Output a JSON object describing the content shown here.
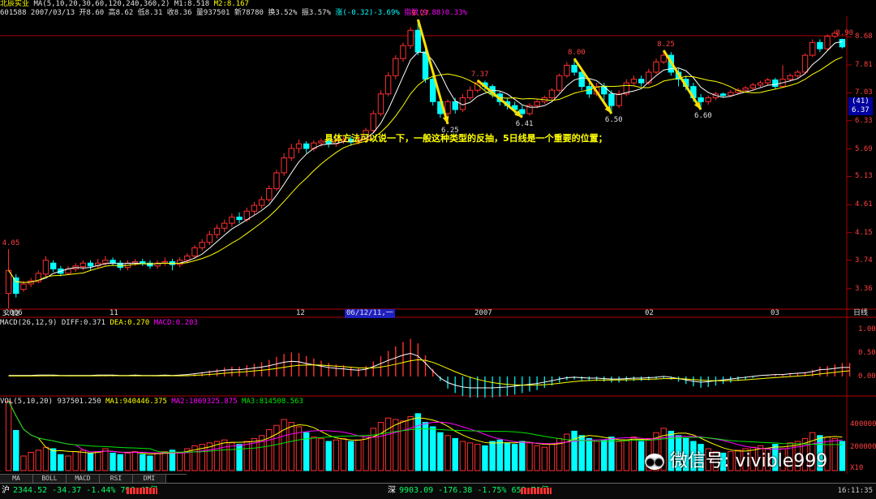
{
  "header": {
    "stock_name": "北辰实业",
    "ma_label": "MA(5,10,20,30,60,120,240,360,2)",
    "m1": "M1:8.518",
    "m2": "M2:8.167",
    "line2": "601588 2007/03/13 开8.60 高8.62 低8.31 收8.36 量937501 新78780 换3.52% 振3.57%",
    "change": "涨(-0.32)-3.69%",
    "index": "指数(9.88)0.33%"
  },
  "price_axis": {
    "ticks": [
      "8.68",
      "7.81",
      "7.03",
      "6.33",
      "5.69",
      "5.13",
      "4.61",
      "4.15",
      "3.74",
      "3.36"
    ],
    "badge_top": "(41)",
    "badge_bottom": "6.37"
  },
  "time_axis": {
    "labels": [
      "2006",
      "11",
      "12",
      "06/12/11,一",
      "2007",
      "02",
      "03",
      "日线"
    ]
  },
  "annotations": {
    "labels": [
      "9.27",
      "6.25",
      "7.37",
      "6.41",
      "8.00",
      "6.50",
      "8.25",
      "6.60",
      "8.90",
      "4.05",
      "3.12"
    ],
    "note": "具体方法可以说一下，一般这种类型的反抽，5日线是一个重要的位置；"
  },
  "macd_panel": {
    "title": "MACD(26,12,9)",
    "diff": "DIFF:0.371",
    "dea": "DEA:0.270",
    "macd": "MACD:0.203",
    "ticks": [
      "1.00",
      "0.50",
      "0.00"
    ]
  },
  "volume_panel": {
    "title": "VOL(5,10,20)",
    "vol": "937501.250",
    "ma1": "MA1:940446.375",
    "ma2": "MA2:1069325.875",
    "ma3": "MA3:814508.563",
    "ticks": [
      "400000",
      "200000",
      "X10"
    ]
  },
  "tabs": [
    "MA",
    "BOLL",
    "MACD",
    "RSI",
    "DMI"
  ],
  "status_bar": {
    "sh_label": "沪",
    "sh_value": "2344.52 -34.37 -1.44% 796.42亿",
    "sz_label": "深",
    "sz_value": "9903.09 -176.38 -1.75% 652.70亿",
    "time": "16:11:35"
  },
  "watermark": "微信号: vivible999",
  "colors": {
    "up": "#ff3030",
    "down": "#00ffff",
    "ma5": "#ffffff",
    "ma10": "#ffff00",
    "ma20": "#ff00ff",
    "arrow": "#ffe000"
  },
  "chart_data": {
    "type": "candlestick",
    "title": "北辰实业",
    "ylim": [
      3.12,
      9.27
    ],
    "y_scale": "log",
    "candles": [
      [
        3.3,
        3.6,
        3.12,
        3.9
      ],
      [
        3.5,
        3.3,
        3.25,
        3.55
      ],
      [
        3.35,
        3.42,
        3.32,
        3.46
      ],
      [
        3.42,
        3.46,
        3.38,
        3.5
      ],
      [
        3.45,
        3.56,
        3.43,
        3.6
      ],
      [
        3.55,
        3.74,
        3.52,
        3.8
      ],
      [
        3.7,
        3.62,
        3.58,
        3.74
      ],
      [
        3.62,
        3.56,
        3.52,
        3.66
      ],
      [
        3.56,
        3.62,
        3.54,
        3.66
      ],
      [
        3.62,
        3.66,
        3.58,
        3.7
      ],
      [
        3.65,
        3.7,
        3.6,
        3.74
      ],
      [
        3.7,
        3.66,
        3.6,
        3.74
      ],
      [
        3.66,
        3.7,
        3.62,
        3.76
      ],
      [
        3.7,
        3.74,
        3.66,
        3.8
      ],
      [
        3.74,
        3.7,
        3.66,
        3.78
      ],
      [
        3.7,
        3.64,
        3.6,
        3.74
      ],
      [
        3.64,
        3.7,
        3.6,
        3.74
      ],
      [
        3.7,
        3.72,
        3.66,
        3.76
      ],
      [
        3.72,
        3.7,
        3.66,
        3.76
      ],
      [
        3.7,
        3.66,
        3.62,
        3.74
      ],
      [
        3.66,
        3.7,
        3.62,
        3.74
      ],
      [
        3.7,
        3.72,
        3.66,
        3.78
      ],
      [
        3.72,
        3.68,
        3.6,
        3.76
      ],
      [
        3.68,
        3.74,
        3.64,
        3.78
      ],
      [
        3.74,
        3.8,
        3.7,
        3.84
      ],
      [
        3.8,
        3.92,
        3.76,
        3.96
      ],
      [
        3.92,
        4.0,
        3.88,
        4.05
      ],
      [
        4.0,
        4.12,
        3.96,
        4.18
      ],
      [
        4.12,
        4.22,
        4.06,
        4.28
      ],
      [
        4.22,
        4.3,
        4.16,
        4.36
      ],
      [
        4.3,
        4.4,
        4.24,
        4.46
      ],
      [
        4.4,
        4.36,
        4.3,
        4.48
      ],
      [
        4.36,
        4.5,
        4.32,
        4.56
      ],
      [
        4.5,
        4.6,
        4.44,
        4.66
      ],
      [
        4.6,
        4.7,
        4.54,
        4.76
      ],
      [
        4.7,
        4.9,
        4.66,
        4.96
      ],
      [
        4.9,
        5.2,
        4.86,
        5.26
      ],
      [
        5.2,
        5.5,
        5.14,
        5.6
      ],
      [
        5.5,
        5.7,
        5.44,
        5.8
      ],
      [
        5.7,
        5.8,
        5.6,
        5.9
      ],
      [
        5.8,
        5.7,
        5.6,
        5.86
      ],
      [
        5.7,
        5.82,
        5.64,
        5.88
      ],
      [
        5.82,
        5.86,
        5.74,
        5.92
      ],
      [
        5.86,
        5.8,
        5.72,
        5.92
      ],
      [
        5.8,
        5.86,
        5.74,
        5.94
      ],
      [
        5.86,
        5.9,
        5.8,
        5.96
      ],
      [
        5.9,
        5.84,
        5.76,
        5.96
      ],
      [
        5.84,
        5.9,
        5.78,
        5.98
      ],
      [
        5.9,
        6.1,
        5.86,
        6.16
      ],
      [
        6.1,
        6.5,
        6.04,
        6.58
      ],
      [
        6.5,
        7.0,
        6.44,
        7.1
      ],
      [
        7.0,
        7.5,
        6.94,
        7.6
      ],
      [
        7.5,
        8.0,
        7.4,
        8.1
      ],
      [
        8.0,
        8.4,
        7.9,
        8.5
      ],
      [
        8.4,
        8.9,
        8.3,
        9.0
      ],
      [
        8.9,
        8.2,
        8.1,
        9.27
      ],
      [
        8.2,
        7.4,
        7.3,
        8.3
      ],
      [
        7.4,
        6.8,
        6.7,
        7.5
      ],
      [
        6.8,
        6.5,
        6.4,
        6.9
      ],
      [
        6.5,
        6.8,
        6.25,
        6.86
      ],
      [
        6.8,
        6.6,
        6.5,
        6.9
      ],
      [
        6.6,
        6.9,
        6.54,
        7.0
      ],
      [
        6.9,
        7.1,
        6.84,
        7.2
      ],
      [
        7.1,
        7.3,
        7.04,
        7.37
      ],
      [
        7.3,
        7.2,
        7.1,
        7.36
      ],
      [
        7.2,
        7.0,
        6.9,
        7.26
      ],
      [
        7.0,
        6.8,
        6.7,
        7.06
      ],
      [
        6.8,
        6.7,
        6.6,
        6.9
      ],
      [
        6.7,
        6.6,
        6.5,
        6.8
      ],
      [
        6.6,
        6.5,
        6.41,
        6.7
      ],
      [
        6.5,
        6.7,
        6.45,
        6.76
      ],
      [
        6.7,
        6.8,
        6.64,
        6.86
      ],
      [
        6.8,
        6.9,
        6.74,
        6.96
      ],
      [
        6.9,
        7.1,
        6.84,
        7.16
      ],
      [
        7.1,
        7.5,
        7.04,
        7.56
      ],
      [
        7.5,
        7.8,
        7.44,
        7.9
      ],
      [
        7.8,
        7.6,
        7.5,
        8.0
      ],
      [
        7.6,
        7.2,
        7.1,
        7.7
      ],
      [
        7.2,
        7.0,
        6.9,
        7.3
      ],
      [
        7.0,
        7.2,
        6.94,
        7.3
      ],
      [
        7.2,
        7.0,
        6.8,
        7.3
      ],
      [
        7.0,
        6.7,
        6.5,
        7.1
      ],
      [
        6.7,
        7.0,
        6.64,
        7.1
      ],
      [
        7.0,
        7.3,
        6.94,
        7.4
      ],
      [
        7.3,
        7.4,
        7.24,
        7.5
      ],
      [
        7.4,
        7.3,
        7.2,
        7.5
      ],
      [
        7.3,
        7.6,
        7.24,
        7.7
      ],
      [
        7.6,
        7.9,
        7.54,
        8.0
      ],
      [
        7.9,
        8.1,
        7.84,
        8.25
      ],
      [
        8.1,
        7.6,
        7.5,
        8.2
      ],
      [
        7.6,
        7.4,
        7.2,
        7.7
      ],
      [
        7.4,
        7.2,
        7.1,
        7.5
      ],
      [
        7.2,
        6.9,
        6.8,
        7.3
      ],
      [
        6.9,
        6.8,
        6.6,
        7.0
      ],
      [
        6.8,
        6.9,
        6.72,
        6.96
      ],
      [
        6.9,
        7.0,
        6.84,
        7.06
      ],
      [
        7.0,
        6.96,
        6.9,
        7.04
      ],
      [
        6.96,
        7.04,
        6.92,
        7.1
      ],
      [
        7.04,
        7.1,
        6.98,
        7.16
      ],
      [
        7.1,
        7.16,
        7.04,
        7.22
      ],
      [
        7.16,
        7.24,
        7.1,
        7.3
      ],
      [
        7.24,
        7.3,
        7.18,
        7.36
      ],
      [
        7.3,
        7.38,
        7.24,
        7.44
      ],
      [
        7.38,
        7.2,
        7.14,
        7.44
      ],
      [
        7.2,
        7.4,
        7.16,
        7.8
      ],
      [
        7.4,
        7.5,
        7.34,
        7.56
      ],
      [
        7.5,
        7.6,
        7.44,
        7.66
      ],
      [
        7.6,
        8.1,
        7.54,
        8.16
      ],
      [
        8.1,
        8.5,
        8.04,
        8.6
      ],
      [
        8.5,
        8.3,
        8.2,
        8.6
      ],
      [
        8.3,
        8.7,
        8.24,
        8.76
      ],
      [
        8.7,
        8.8,
        8.64,
        8.9
      ],
      [
        8.6,
        8.36,
        8.31,
        8.62
      ]
    ],
    "volume": [
      95,
      55,
      20,
      25,
      28,
      32,
      30,
      22,
      20,
      26,
      28,
      24,
      26,
      30,
      24,
      22,
      24,
      26,
      22,
      20,
      24,
      26,
      28,
      24,
      30,
      34,
      36,
      38,
      40,
      42,
      38,
      36,
      40,
      44,
      48,
      56,
      62,
      70,
      66,
      60,
      52,
      46,
      44,
      40,
      42,
      44,
      40,
      42,
      48,
      58,
      66,
      72,
      70,
      68,
      74,
      78,
      66,
      60,
      52,
      48,
      44,
      40,
      38,
      36,
      34,
      40,
      42,
      38,
      36,
      40,
      38,
      34,
      32,
      36,
      44,
      50,
      54,
      48,
      44,
      40,
      42,
      46,
      40,
      42,
      46,
      40,
      44,
      52,
      58,
      54,
      48,
      44,
      40,
      36,
      30,
      26,
      24,
      26,
      28,
      30,
      32,
      34,
      30,
      36,
      30,
      38,
      40,
      44,
      52,
      48,
      46,
      44,
      40
    ],
    "macd_hist": [
      0.0,
      0.0,
      0.0,
      0.0,
      0.01,
      0.01,
      0.01,
      0.0,
      0.0,
      0.0,
      0.0,
      0.0,
      0.01,
      0.01,
      0.01,
      0.0,
      0.0,
      0.01,
      0.0,
      0.0,
      0.0,
      0.01,
      0.0,
      0.01,
      0.02,
      0.04,
      0.06,
      0.08,
      0.1,
      0.12,
      0.13,
      0.13,
      0.15,
      0.17,
      0.19,
      0.22,
      0.26,
      0.3,
      0.32,
      0.31,
      0.27,
      0.24,
      0.21,
      0.18,
      0.16,
      0.15,
      0.13,
      0.12,
      0.14,
      0.2,
      0.27,
      0.34,
      0.4,
      0.46,
      0.5,
      0.44,
      0.28,
      0.1,
      -0.06,
      -0.16,
      -0.22,
      -0.26,
      -0.28,
      -0.28,
      -0.28,
      -0.28,
      -0.27,
      -0.26,
      -0.24,
      -0.22,
      -0.2,
      -0.18,
      -0.15,
      -0.12,
      -0.08,
      -0.05,
      -0.04,
      -0.05,
      -0.06,
      -0.06,
      -0.07,
      -0.08,
      -0.08,
      -0.07,
      -0.06,
      -0.06,
      -0.05,
      -0.04,
      -0.02,
      -0.04,
      -0.07,
      -0.1,
      -0.13,
      -0.15,
      -0.14,
      -0.12,
      -0.1,
      -0.08,
      -0.06,
      -0.04,
      -0.02,
      0.0,
      0.01,
      0.02,
      0.02,
      0.04,
      0.05,
      0.06,
      0.09,
      0.13,
      0.14,
      0.16,
      0.18,
      0.18
    ]
  }
}
